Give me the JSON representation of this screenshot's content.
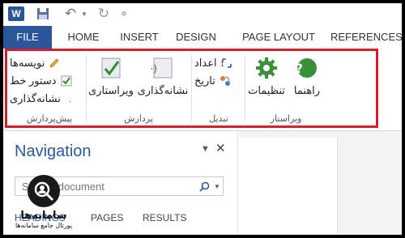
{
  "quick_access": {
    "app_icon_letter": "W",
    "icons": [
      "word-icon",
      "save-icon",
      "undo-icon",
      "redo-icon",
      "customize-icon"
    ]
  },
  "tabs": {
    "file": "FILE",
    "home": "HOME",
    "insert": "INSERT",
    "design": "DESIGN",
    "page_layout": "PAGE LAYOUT",
    "references": "REFERENCES"
  },
  "ribbon": {
    "group_preprocess": {
      "label": "پیش‌پردازش",
      "items": [
        "نویسه‌ها",
        "دستور خط",
        "نشانه‌گذاری"
      ]
    },
    "group_process": {
      "label": "پردازش",
      "items": [
        "ویراستاری",
        "نشانه‌گذاری"
      ]
    },
    "group_convert": {
      "label": "تبدیل",
      "items": [
        "اعداد",
        "تاریخ"
      ]
    },
    "group_editor": {
      "label": "ویراستار",
      "items": [
        "تنظیمات",
        "راهنما"
      ]
    },
    "accent_color": "#d0202e"
  },
  "navigation": {
    "title": "Navigation",
    "search_placeholder": "Search document",
    "tabs": [
      "HEADINGS",
      "PAGES",
      "RESULTS"
    ]
  },
  "watermark": {
    "name": "سامانه‌ها",
    "subtitle": "پورتال جامع سامانه‌ها"
  },
  "colors": {
    "word_blue": "#2b579a",
    "highlight_red": "#d0202e",
    "gear_green": "#3a8f3a"
  }
}
